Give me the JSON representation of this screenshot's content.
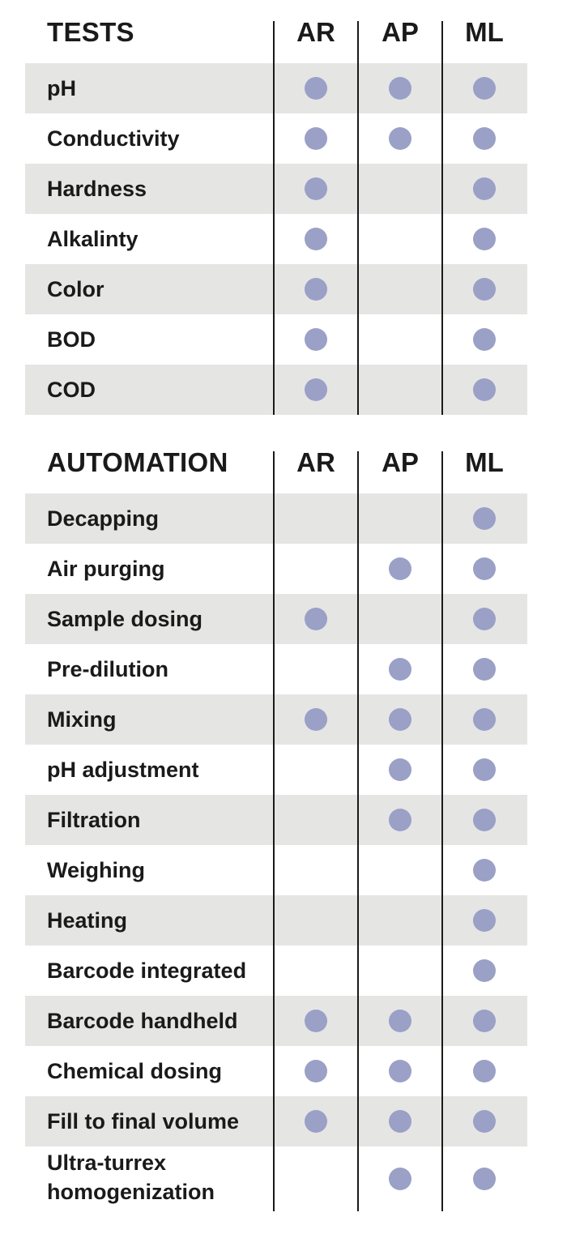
{
  "colors": {
    "dot": "#9aa0c6",
    "row_shade": "#e5e5e4",
    "divider": "#1a1a1a"
  },
  "tables": [
    {
      "title": "TESTS",
      "columns": [
        "AR",
        "AP",
        "ML"
      ],
      "rows": [
        {
          "label": "pH",
          "marks": [
            true,
            true,
            true
          ]
        },
        {
          "label": "Conductivity",
          "marks": [
            true,
            true,
            true
          ]
        },
        {
          "label": "Hardness",
          "marks": [
            true,
            false,
            true
          ]
        },
        {
          "label": "Alkalinty",
          "marks": [
            true,
            false,
            true
          ]
        },
        {
          "label": "Color",
          "marks": [
            true,
            false,
            true
          ]
        },
        {
          "label": "BOD",
          "marks": [
            true,
            false,
            true
          ]
        },
        {
          "label": "COD",
          "marks": [
            true,
            false,
            true
          ]
        }
      ]
    },
    {
      "title": "AUTOMATION",
      "columns": [
        "AR",
        "AP",
        "ML"
      ],
      "rows": [
        {
          "label": "Decapping",
          "marks": [
            false,
            false,
            true
          ]
        },
        {
          "label": "Air purging",
          "marks": [
            false,
            true,
            true
          ]
        },
        {
          "label": "Sample dosing",
          "marks": [
            true,
            false,
            true
          ]
        },
        {
          "label": "Pre-dilution",
          "marks": [
            false,
            true,
            true
          ]
        },
        {
          "label": "Mixing",
          "marks": [
            true,
            true,
            true
          ]
        },
        {
          "label": "pH adjustment",
          "marks": [
            false,
            true,
            true
          ]
        },
        {
          "label": "Filtration",
          "marks": [
            false,
            true,
            true
          ]
        },
        {
          "label": "Weighing",
          "marks": [
            false,
            false,
            true
          ]
        },
        {
          "label": "Heating",
          "marks": [
            false,
            false,
            true
          ]
        },
        {
          "label": "Barcode integrated",
          "marks": [
            false,
            false,
            true
          ]
        },
        {
          "label": "Barcode handheld",
          "marks": [
            true,
            true,
            true
          ]
        },
        {
          "label": "Chemical dosing",
          "marks": [
            true,
            true,
            true
          ]
        },
        {
          "label": "Fill to final volume",
          "marks": [
            true,
            true,
            true
          ]
        },
        {
          "label": "Ultra-turrex homogenization",
          "marks": [
            false,
            true,
            true
          ]
        }
      ]
    }
  ]
}
